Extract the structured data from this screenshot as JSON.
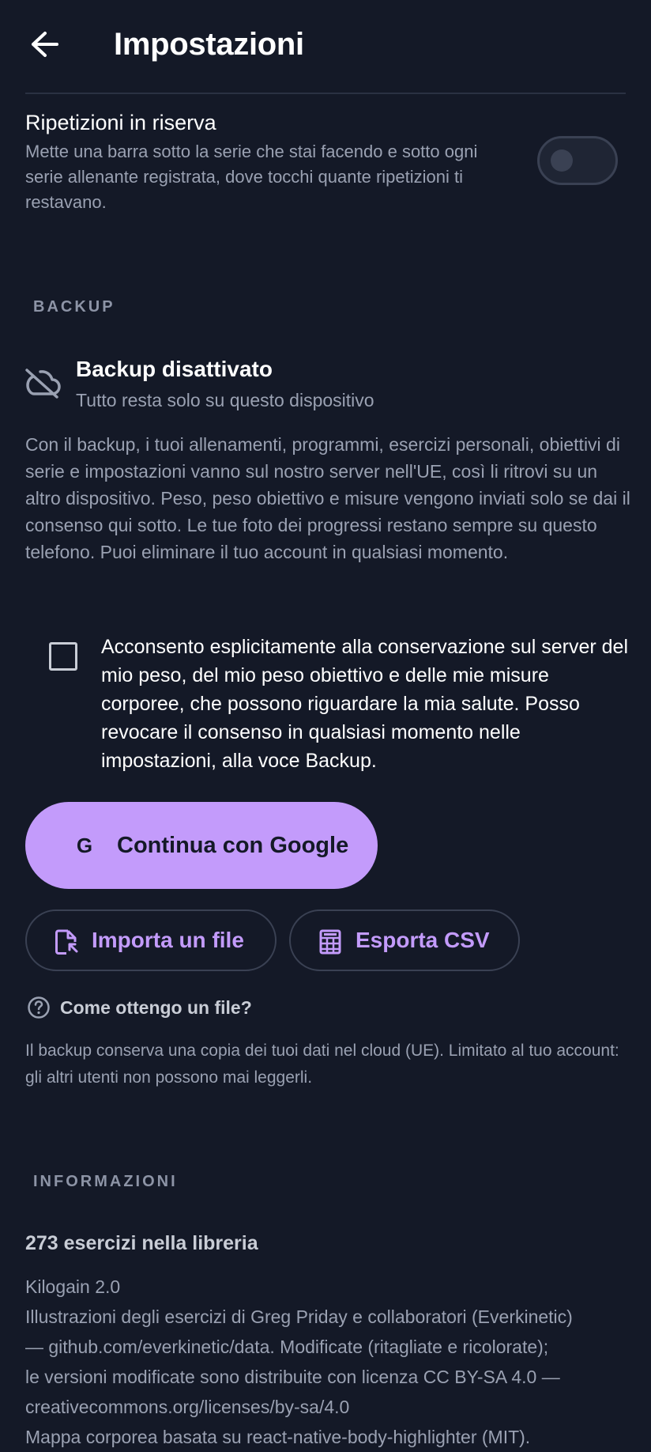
{
  "header": {
    "title": "Impostazioni",
    "back_icon": "arrow-left-icon"
  },
  "reserve_reps": {
    "title": "Ripetizioni in riserva",
    "description": "Mette una barra sotto la serie che stai facendo e sotto ogni serie allenante registrata, dove tocchi quante ripetizioni ti restavano.",
    "enabled": false
  },
  "backup_section": {
    "label": "BACKUP",
    "status_icon": "cloud-off-icon",
    "status_title": "Backup disattivato",
    "status_subtitle": "Tutto resta solo su questo dispositivo",
    "description": "Con il backup, i tuoi allenamenti, programmi, esercizi personali, obiettivi di serie e impostazioni vanno sul nostro server nell'UE, così li ritrovi su un altro dispositivo. Peso, peso obiettivo e misure vengono inviati solo se dai il consenso qui sotto. Le tue foto dei progressi restano sempre su questo telefono. Puoi eliminare il tuo account in qualsiasi momento.",
    "consent_checked": false,
    "consent_text": "Acconsento esplicitamente alla conservazione sul server del mio peso, del mio peso obiettivo e delle mie misure corporee, che possono riguardare la mia salute. Posso revocare il consenso in qualsiasi momento nelle impostazioni, alla voce Backup.",
    "google_button": {
      "icon_glyph": "G",
      "label": "Continua con Google"
    },
    "import_button": {
      "icon": "file-import-icon",
      "label": "Importa un file"
    },
    "export_button": {
      "icon": "spreadsheet-icon",
      "label": "Esporta CSV"
    },
    "help": {
      "icon": "help-circle-icon",
      "label": "Come ottengo un file?"
    },
    "note": "Il backup conserva una copia dei tuoi dati nel cloud (UE). Limitato al tuo account: gli altri utenti non possono mai leggerli."
  },
  "info_section": {
    "label": "INFORMAZIONI",
    "library_count": "273 esercizi nella libreria",
    "lines": [
      "Kilogain 2.0",
      "Illustrazioni degli esercizi di Greg Priday e collaboratori (Everkinetic)",
      "— github.com/everkinetic/data. Modificate (ritagliate e ricolorate);",
      "le versioni modificate sono distribuite con licenza CC BY-SA 4.0 —",
      "creativecommons.org/licenses/by-sa/4.0",
      "Mappa corporea basata su react-native-body-highlighter (MIT)."
    ]
  },
  "colors": {
    "background": "#141927",
    "accent": "#c39bfb",
    "text_primary": "#ffffff",
    "text_secondary": "#9aa1b2",
    "section_label": "#8d94a6",
    "border": "#3a4153"
  }
}
